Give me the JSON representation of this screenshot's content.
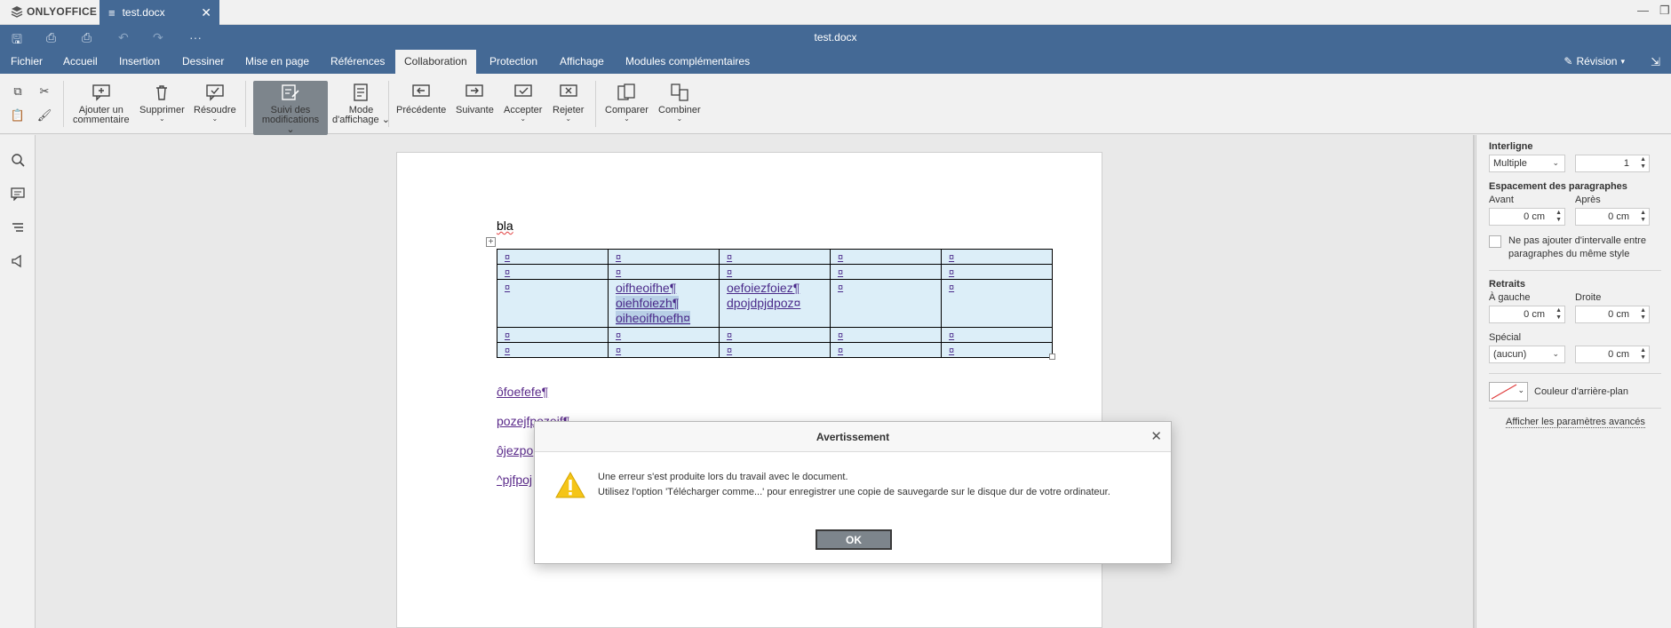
{
  "app": {
    "brand": "ONLYOFFICE",
    "tab_title": "test.docx",
    "doc_title": "test.docx"
  },
  "menu_tabs": [
    "Fichier",
    "Accueil",
    "Insertion",
    "Dessiner",
    "Mise en page",
    "Références",
    "Collaboration",
    "Protection",
    "Affichage",
    "Modules complémentaires"
  ],
  "active_tab": "Collaboration",
  "revision_label": "Révision",
  "toolbar": {
    "add_comment": [
      "Ajouter un",
      "commentaire"
    ],
    "delete": "Supprimer",
    "resolve": "Résoudre",
    "track_changes": [
      "Suivi des",
      "modifications"
    ],
    "display_mode": [
      "Mode",
      "d'affichage"
    ],
    "previous": "Précédente",
    "next": "Suivante",
    "accept": "Accepter",
    "reject": "Rejeter",
    "compare": "Comparer",
    "combine": "Combiner"
  },
  "document": {
    "first_word": "bla",
    "cell_marker": "¤",
    "cell_r3c2": [
      "oifheoifhe¶",
      "oiehfoiezh¶",
      "oiheoifhoefh¤"
    ],
    "cell_r3c3": [
      "oefoiezfoiez¶",
      "dpojdpjdpoz¤"
    ],
    "paragraphs": [
      "ôfoefefe¶",
      "pozejfpozejf¶",
      "ôjezpo",
      "^pjfpoj"
    ]
  },
  "right_panel": {
    "line_spacing_title": "Interligne",
    "line_spacing_type": "Multiple",
    "line_spacing_value": "1",
    "para_spacing_title": "Espacement des paragraphes",
    "before_label": "Avant",
    "after_label": "Après",
    "before_value": "0 cm",
    "after_value": "0 cm",
    "no_interval_line1": "Ne pas ajouter d'intervalle entre",
    "no_interval_line2": "paragraphes du même style",
    "indents_title": "Retraits",
    "left_label": "À gauche",
    "right_label": "Droite",
    "left_value": "0 cm",
    "right_value": "0 cm",
    "special_label": "Spécial",
    "special_type": "(aucun)",
    "special_value": "0 cm",
    "bg_color_label": "Couleur d'arrière-plan",
    "advanced_link": "Afficher les paramètres avancés"
  },
  "dialog": {
    "title": "Avertissement",
    "line1": "Une erreur s'est produite lors du travail avec le document.",
    "line2": "Utilisez l'option 'Télécharger comme...' pour enregistrer une copie de sauvegarde sur le disque dur de votre ordinateur.",
    "ok_label": "OK"
  },
  "colors": {
    "header_blue": "#446995",
    "table_fill": "#dceef8",
    "insert_text": "#5a2a8a",
    "warning_yellow": "#f5c518"
  }
}
